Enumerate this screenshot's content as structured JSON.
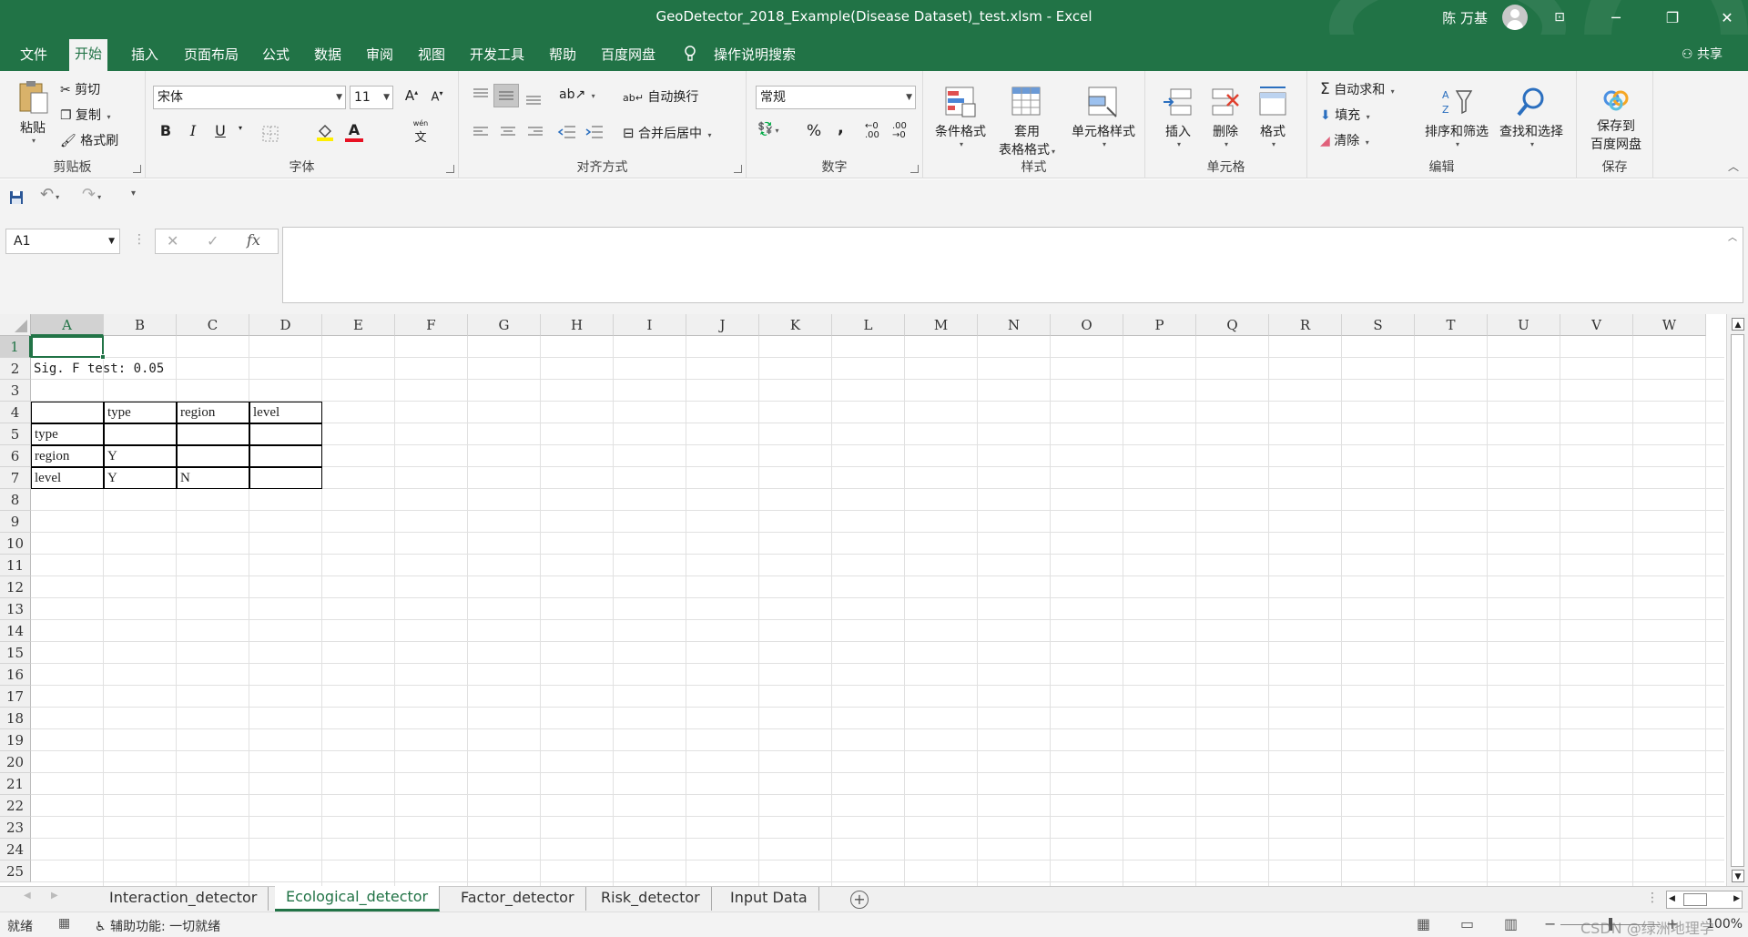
{
  "window": {
    "title": "GeoDetector_2018_Example(Disease Dataset)_test.xlsm  -  Excel",
    "user": "陈 万基",
    "minimize": "─",
    "restore": "❐",
    "close": "✕",
    "layout_icon": "⊡"
  },
  "menu": {
    "tabs": [
      "文件",
      "开始",
      "插入",
      "页面布局",
      "公式",
      "数据",
      "审阅",
      "视图",
      "开发工具",
      "帮助",
      "百度网盘"
    ],
    "active_tab": "开始",
    "tell_me": "操作说明搜索",
    "share": "共享"
  },
  "ribbon": {
    "clipboard": {
      "label": "剪贴板",
      "paste": "粘贴",
      "cut": "剪切",
      "copy": "复制",
      "format_painter": "格式刷"
    },
    "font": {
      "label": "字体",
      "name": "宋体",
      "size": "11",
      "bold": "B",
      "italic": "I",
      "underline": "U",
      "grow": "A",
      "shrink": "A",
      "phonetic": "文",
      "font_color_letter": "A",
      "font_color": "#e81123",
      "fill_color": "#ffef00"
    },
    "alignment": {
      "label": "对齐方式",
      "wrap": "自动换行",
      "merge": "合并后居中"
    },
    "number": {
      "label": "数字",
      "format": "常规",
      "percent": "%",
      "comma": ",",
      "inc_decimal": ".00",
      "dec_decimal": ".00"
    },
    "styles": {
      "label": "样式",
      "conditional": "条件格式",
      "table_line1": "套用",
      "table_line2": "表格格式",
      "cell_styles": "单元格样式"
    },
    "cells": {
      "label": "单元格",
      "insert": "插入",
      "delete": "删除",
      "format": "格式"
    },
    "editing": {
      "label": "编辑",
      "autosum": "自动求和",
      "fill": "填充",
      "clear": "清除",
      "sort_filter": "排序和筛选",
      "find_select": "查找和选择"
    },
    "save": {
      "label": "保存",
      "line1": "保存到",
      "line2": "百度网盘"
    }
  },
  "formula_bar": {
    "name_box": "A1",
    "fx": "fx",
    "value": ""
  },
  "columns": [
    "A",
    "B",
    "C",
    "D",
    "E",
    "F",
    "G",
    "H",
    "I",
    "J",
    "K",
    "L",
    "M",
    "N",
    "O",
    "P",
    "Q",
    "R",
    "S",
    "T",
    "U",
    "V",
    "W"
  ],
  "rows": [
    "1",
    "2",
    "3",
    "4",
    "5",
    "6",
    "7",
    "8",
    "9",
    "10",
    "11",
    "12",
    "13",
    "14",
    "15",
    "16",
    "17",
    "18",
    "19",
    "20",
    "21",
    "22",
    "23",
    "24",
    "25"
  ],
  "sheet": {
    "sig_label": "Sig. F test: 0.05",
    "table": {
      "headers": [
        "",
        "type",
        "region",
        "level"
      ],
      "rows": [
        [
          "type",
          "",
          "",
          ""
        ],
        [
          "region",
          "Y",
          "",
          ""
        ],
        [
          "level",
          "Y",
          "N",
          ""
        ]
      ]
    }
  },
  "sheet_tabs": [
    "Interaction_detector",
    "Ecological_detector",
    "Factor_detector",
    "Risk_detector",
    "Input Data"
  ],
  "active_sheet": "Ecological_detector",
  "status": {
    "ready": "就绪",
    "accessibility": "辅助功能: 一切就绪",
    "zoom": "100%",
    "watermark": "CSDN @绿洲地理学"
  },
  "accent_color": "#217346"
}
